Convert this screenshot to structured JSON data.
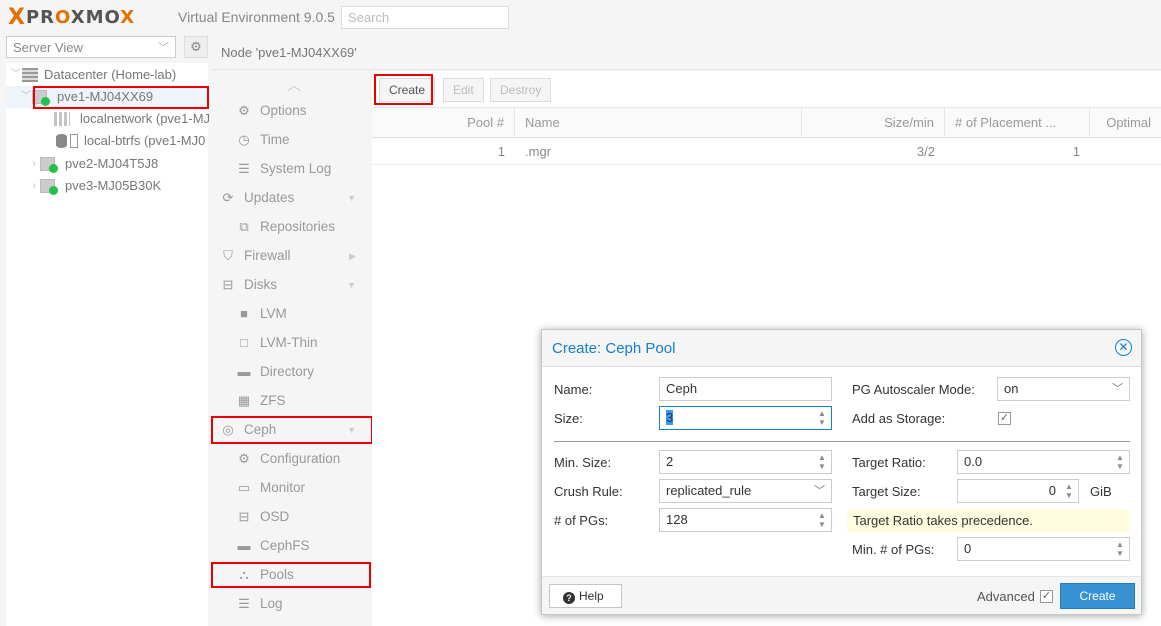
{
  "header": {
    "logo_x": "X",
    "logo_word": "PROXMOX",
    "product": "Virtual Environment 9.0.5",
    "search_placeholder": "Search"
  },
  "tree": {
    "view": "Server View",
    "items": [
      {
        "label": "Datacenter (Home-lab)"
      },
      {
        "label": "pve1-MJ04XX69"
      },
      {
        "label": "localnetwork (pve1-MJ"
      },
      {
        "label": "local-btrfs (pve1-MJ0"
      },
      {
        "label": "pve2-MJ04T5J8"
      },
      {
        "label": "pve3-MJ05B30K"
      }
    ]
  },
  "node": {
    "title": "Node 'pve1-MJ04XX69'"
  },
  "nav": {
    "items": [
      {
        "label": "Options",
        "icon": "gear-icon"
      },
      {
        "label": "Time",
        "icon": "clock-icon"
      },
      {
        "label": "System Log",
        "icon": "list-icon"
      },
      {
        "label": "Updates",
        "icon": "refresh-icon"
      },
      {
        "label": "Repositories",
        "icon": "repository-icon"
      },
      {
        "label": "Firewall",
        "icon": "shield-icon"
      },
      {
        "label": "Disks",
        "icon": "hdd-icon"
      },
      {
        "label": "LVM",
        "icon": "square-icon"
      },
      {
        "label": "LVM-Thin",
        "icon": "square-outline-icon"
      },
      {
        "label": "Directory",
        "icon": "folder-icon"
      },
      {
        "label": "ZFS",
        "icon": "grid-icon"
      },
      {
        "label": "Ceph",
        "icon": "ceph-icon"
      },
      {
        "label": "Configuration",
        "icon": "gear-icon"
      },
      {
        "label": "Monitor",
        "icon": "monitor-icon"
      },
      {
        "label": "OSD",
        "icon": "hdd-icon"
      },
      {
        "label": "CephFS",
        "icon": "folder-icon"
      },
      {
        "label": "Pools",
        "icon": "sitemap-icon"
      },
      {
        "label": "Log",
        "icon": "list-icon"
      }
    ]
  },
  "toolbar": {
    "create": "Create",
    "edit": "Edit",
    "destroy": "Destroy"
  },
  "grid": {
    "columns": [
      "Pool #",
      "Name",
      "Size/min",
      "# of Placement ...",
      "Optimal"
    ],
    "rows": [
      {
        "pool": "1",
        "name": ".mgr",
        "size": "3/2",
        "pgs": "1"
      }
    ]
  },
  "dialog": {
    "title": "Create: Ceph Pool",
    "name_label": "Name:",
    "name_value": "Ceph",
    "size_label": "Size:",
    "size_value": "3",
    "autoscale_label": "PG Autoscaler Mode:",
    "autoscale_value": "on",
    "storage_label": "Add as Storage:",
    "storage_checked": "✓",
    "minsize_label": "Min. Size:",
    "minsize_value": "2",
    "crush_label": "Crush Rule:",
    "crush_value": "replicated_rule",
    "pgs_label": "# of PGs:",
    "pgs_value": "128",
    "ratio_label": "Target Ratio:",
    "ratio_value": "0.0",
    "tsize_label": "Target Size:",
    "tsize_value": "0",
    "tsize_unit": "GiB",
    "notice": "Target Ratio takes precedence.",
    "minpgs_label": "Min. # of PGs:",
    "minpgs_value": "0",
    "help": "Help",
    "advanced": "Advanced",
    "advanced_checked": "✓",
    "create": "Create"
  }
}
